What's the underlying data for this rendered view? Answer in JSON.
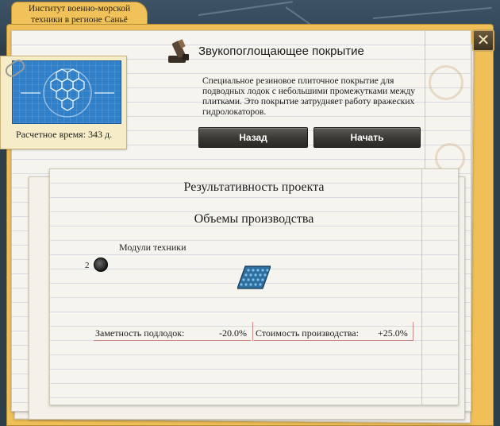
{
  "folder": {
    "tab_label": "Институт военно-морской техники в регионе Саньё"
  },
  "project": {
    "name": "Звукопоглощающее покрытие",
    "description": "Специальное резиновое плиточное покрытие для подводных лодок с небольшими промежутками между плитками. Это покрытие затрудняет работу вражеских гидролокаторов.",
    "time_label": "Расчетное время: 343 д.",
    "icon": "tool-icon",
    "blueprint_icon": "hexagon-blueprint-icon"
  },
  "buttons": {
    "back": "Назад",
    "start": "Начать",
    "close": "✕"
  },
  "results": {
    "title": "Результативность проекта",
    "production_title": "Объемы производства",
    "modules_label": "Модули техники",
    "module_count": "2",
    "stats": [
      {
        "label": "Заметность подлодок:",
        "value": "-20.0%"
      },
      {
        "label": "Стоимость производства:",
        "value": "+25.0%"
      }
    ]
  },
  "colors": {
    "folder": "#f0bf58",
    "blueprint": "#2f7fc9",
    "button": "#3a3833"
  }
}
